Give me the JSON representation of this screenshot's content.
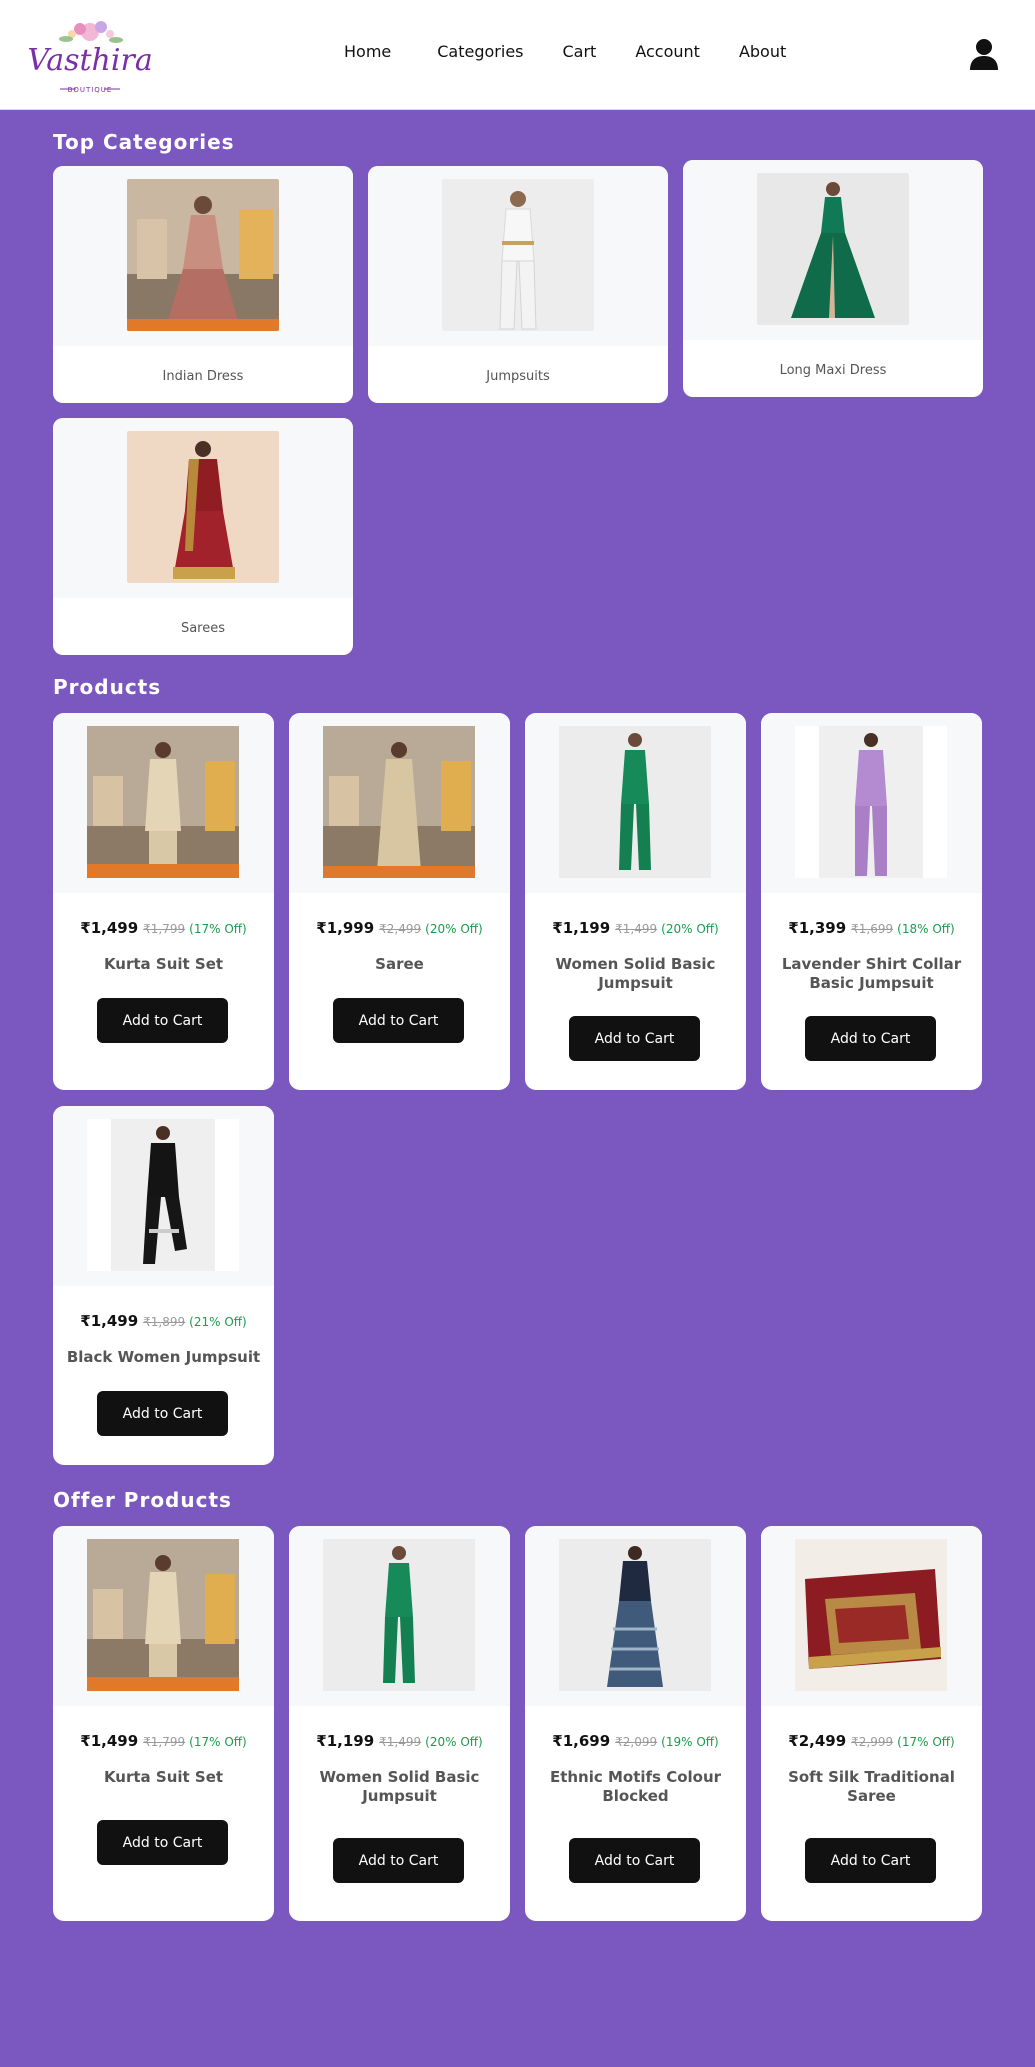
{
  "brand": {
    "name": "Vasthira",
    "tagline": "BOUTIQUE"
  },
  "nav": [
    {
      "label": "Home"
    },
    {
      "label": "Categories"
    },
    {
      "label": "Cart"
    },
    {
      "label": "Account"
    },
    {
      "label": "About"
    }
  ],
  "sections": {
    "top_categories": "Top Categories",
    "products": "Products",
    "offer_products": "Offer Products"
  },
  "categories": [
    {
      "label": "Indian Dress",
      "image": "indian-dress-photo"
    },
    {
      "label": "Jumpsuits",
      "image": "jumpsuit-photo"
    },
    {
      "label": "Long Maxi Dress",
      "image": "maxi-dress-photo"
    },
    {
      "label": "Sarees",
      "image": "saree-photo"
    }
  ],
  "products": [
    {
      "price": "₹1,499",
      "mrp": "₹1,799",
      "off": "(17% Off)",
      "name": "Kurta Suit Set",
      "button": "Add to Cart"
    },
    {
      "price": "₹1,999",
      "mrp": "₹2,499",
      "off": "(20% Off)",
      "name": "Saree",
      "button": "Add to Cart"
    },
    {
      "price": "₹1,199",
      "mrp": "₹1,499",
      "off": "(20% Off)",
      "name": "Women Solid Basic Jumpsuit",
      "button": "Add to Cart"
    },
    {
      "price": "₹1,399",
      "mrp": "₹1,699",
      "off": "(18% Off)",
      "name": "Lavender Shirt Collar Basic Jumpsuit",
      "button": "Add to Cart"
    },
    {
      "price": "₹1,499",
      "mrp": "₹1,899",
      "off": "(21% Off)",
      "name": "Black Women Jumpsuit",
      "button": "Add to Cart"
    }
  ],
  "offer_products": [
    {
      "price": "₹1,499",
      "mrp": "₹1,799",
      "off": "(17% Off)",
      "name": "Kurta Suit Set",
      "button": "Add to Cart"
    },
    {
      "price": "₹1,199",
      "mrp": "₹1,499",
      "off": "(20% Off)",
      "name": "Women Solid Basic Jumpsuit",
      "button": "Add to Cart"
    },
    {
      "price": "₹1,699",
      "mrp": "₹2,099",
      "off": "(19% Off)",
      "name": "Ethnic Motifs Colour Blocked",
      "button": "Add to Cart"
    },
    {
      "price": "₹2,499",
      "mrp": "₹2,999",
      "off": "(17% Off)",
      "name": "Soft Silk Traditional Saree",
      "button": "Add to Cart"
    }
  ],
  "colors": {
    "background": "#7b58c0",
    "card": "#ffffff",
    "button": "#111111",
    "discount": "#1e9a4c",
    "brand": "#7a2fa8"
  }
}
